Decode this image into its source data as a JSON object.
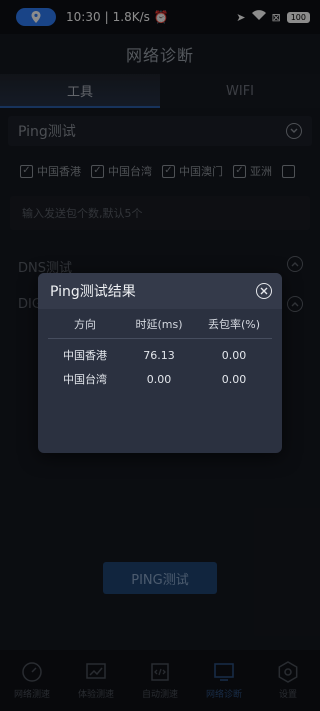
{
  "status_bar": {
    "time": "10:30",
    "speed": "1.8K/s",
    "battery": "100"
  },
  "title": "网络诊断",
  "tabs": [
    {
      "label": "工具",
      "active": true
    },
    {
      "label": "WIFI",
      "active": false
    }
  ],
  "ping_section": {
    "title": "Ping测试",
    "regions": [
      {
        "label": "中国香港",
        "checked": true
      },
      {
        "label": "中国台湾",
        "checked": true
      },
      {
        "label": "中国澳门",
        "checked": true
      },
      {
        "label": "亚洲",
        "checked": true
      },
      {
        "label": "",
        "checked": false
      }
    ],
    "count_placeholder": "输入发送包个数,默认5个"
  },
  "dns_section": {
    "title": "DNS测试"
  },
  "dig_section": {
    "title": "DIG"
  },
  "dialog": {
    "title": "Ping测试结果",
    "columns": [
      "方向",
      "时延(ms)",
      "丢包率(%)"
    ],
    "rows": [
      [
        "中国香港",
        "76.13",
        "0.00"
      ],
      [
        "中国台湾",
        "0.00",
        "0.00"
      ]
    ]
  },
  "ping_button": "PING测试",
  "bottom_nav": [
    {
      "label": "网络测速",
      "icon": "speedometer-icon"
    },
    {
      "label": "体验测速",
      "icon": "chart-icon"
    },
    {
      "label": "自动测速",
      "icon": "code-doc-icon"
    },
    {
      "label": "网络诊断",
      "icon": "monitor-icon",
      "active": true
    },
    {
      "label": "设置",
      "icon": "gear-icon"
    }
  ],
  "colors": {
    "accent": "#2f7cf6",
    "background": "#15181f",
    "dialog": "#2b3140"
  }
}
